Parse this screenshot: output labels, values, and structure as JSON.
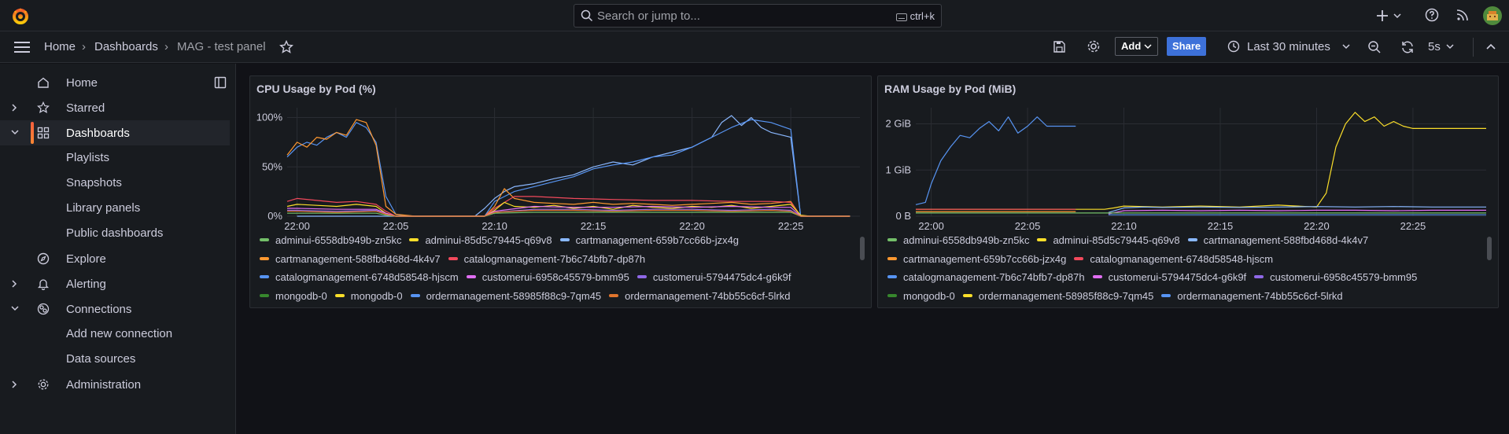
{
  "topbar": {
    "search_placeholder": "Search or jump to...",
    "search_shortcut": "ctrl+k",
    "icons": [
      "grafana-logo",
      "plus-icon",
      "help-icon",
      "rss-icon",
      "avatar"
    ]
  },
  "breadcrumb": {
    "items": [
      "Home",
      "Dashboards",
      "MAG - test panel"
    ]
  },
  "toolbar": {
    "add_label": "Add",
    "share_label": "Share",
    "time_range": "Last 30 minutes",
    "refresh_interval": "5s"
  },
  "sidebar": {
    "items": [
      {
        "label": "Home",
        "icon": "home-icon"
      },
      {
        "label": "Starred",
        "icon": "star-icon"
      },
      {
        "label": "Dashboards",
        "icon": "apps-icon"
      },
      {
        "label": "Playlists"
      },
      {
        "label": "Snapshots"
      },
      {
        "label": "Library panels"
      },
      {
        "label": "Public dashboards"
      },
      {
        "label": "Explore",
        "icon": "compass-icon"
      },
      {
        "label": "Alerting",
        "icon": "bell-icon"
      },
      {
        "label": "Connections",
        "icon": "plug-icon"
      },
      {
        "label": "Add new connection"
      },
      {
        "label": "Data sources"
      },
      {
        "label": "Administration",
        "icon": "cog-icon"
      }
    ]
  },
  "colors": {
    "green": "#73bf69",
    "yellow": "#fade2a",
    "lightblue": "#8ab8ff",
    "orange": "#ff9830",
    "red": "#f2495c",
    "blue": "#5794f2",
    "pink": "#e06ef2",
    "purple": "#8f68e6",
    "darkorange": "#e0752d",
    "darkgreen": "#37872d"
  },
  "panels": [
    {
      "title": "CPU Usage by Pod (%)",
      "legend_rows": [
        [
          {
            "name": "adminui-6558db949b-zn5kc",
            "color": "#73bf69"
          },
          {
            "name": "adminui-85d5c79445-q69v8",
            "color": "#fade2a"
          },
          {
            "name": "cartmanagement-659b7cc66b-jzx4g",
            "color": "#8ab8ff"
          }
        ],
        [
          {
            "name": "cartmanagement-588fbd468d-4k4v7",
            "color": "#ff9830"
          },
          {
            "name": "catalogmanagement-7b6c74bfb7-dp87h",
            "color": "#f2495c"
          }
        ],
        [
          {
            "name": "catalogmanagement-6748d58548-hjscm",
            "color": "#5794f2"
          },
          {
            "name": "customerui-6958c45579-bmm95",
            "color": "#e06ef2"
          },
          {
            "name": "customerui-5794475dc4-g6k9f",
            "color": "#8f68e6"
          }
        ],
        [
          {
            "name": "mongodb-0",
            "color": "#37872d"
          },
          {
            "name": "mongodb-0",
            "color": "#fade2a"
          },
          {
            "name": "ordermanagement-58985f88c9-7qm45",
            "color": "#5794f2"
          },
          {
            "name": "ordermanagement-74bb55c6cf-5lrkd",
            "color": "#e0752d"
          }
        ]
      ]
    },
    {
      "title": "RAM Usage by Pod (MiB)",
      "legend_rows": [
        [
          {
            "name": "adminui-6558db949b-zn5kc",
            "color": "#73bf69"
          },
          {
            "name": "adminui-85d5c79445-q69v8",
            "color": "#fade2a"
          },
          {
            "name": "cartmanagement-588fbd468d-4k4v7",
            "color": "#8ab8ff"
          }
        ],
        [
          {
            "name": "cartmanagement-659b7cc66b-jzx4g",
            "color": "#ff9830"
          },
          {
            "name": "catalogmanagement-6748d58548-hjscm",
            "color": "#f2495c"
          }
        ],
        [
          {
            "name": "catalogmanagement-7b6c74bfb7-dp87h",
            "color": "#5794f2"
          },
          {
            "name": "customerui-5794475dc4-g6k9f",
            "color": "#e06ef2"
          },
          {
            "name": "customerui-6958c45579-bmm95",
            "color": "#8f68e6"
          }
        ],
        [
          {
            "name": "mongodb-0",
            "color": "#37872d"
          },
          {
            "name": "ordermanagement-58985f88c9-7qm45",
            "color": "#fade2a"
          },
          {
            "name": "ordermanagement-74bb55c6cf-5lrkd",
            "color": "#5794f2"
          }
        ]
      ]
    }
  ],
  "chart_data": [
    {
      "type": "line",
      "title": "CPU Usage by Pod (%)",
      "x_ticks": [
        "22:00",
        "22:05",
        "22:10",
        "22:15",
        "22:20",
        "22:25"
      ],
      "y_ticks": [
        "0%",
        "50%",
        "100%"
      ],
      "ylim": [
        0,
        110
      ],
      "x_range_minutes": [
        -0.5,
        28.5
      ],
      "grid": true,
      "legend": "bottom",
      "series": [
        {
          "name": "cartmanagement-659b7cc66b-jzx4g",
          "color": "#8ab8ff",
          "x": [
            0,
            1,
            2,
            3,
            4,
            5,
            6,
            7,
            8,
            9,
            9.5,
            10,
            10.5,
            11,
            12,
            13,
            14,
            15,
            16,
            17,
            18,
            19,
            20,
            21,
            21.5,
            22,
            22.5,
            23,
            23.5,
            24,
            25,
            25.5,
            26,
            27,
            28
          ],
          "y": [
            0,
            0,
            0,
            0,
            0,
            0,
            0,
            0,
            0,
            0,
            8,
            18,
            25,
            30,
            33,
            38,
            42,
            50,
            55,
            52,
            60,
            65,
            70,
            80,
            95,
            102,
            92,
            100,
            90,
            85,
            80,
            0,
            0,
            0,
            0
          ]
        },
        {
          "name": "catalogmanagement-6748d58548-hjscm",
          "color": "#5794f2",
          "x": [
            -0.5,
            0,
            0.5,
            1,
            1.5,
            2,
            2.5,
            3,
            3.5,
            4,
            4.5,
            5,
            5.5,
            9.5,
            10,
            11,
            12,
            13,
            14,
            15,
            16,
            17,
            18,
            19,
            20,
            21,
            22,
            23,
            24,
            25,
            25.5,
            26,
            28
          ],
          "y": [
            60,
            70,
            75,
            72,
            80,
            85,
            80,
            95,
            90,
            75,
            20,
            2,
            0,
            0,
            15,
            25,
            30,
            35,
            40,
            48,
            52,
            55,
            60,
            62,
            70,
            80,
            90,
            98,
            95,
            88,
            0,
            0,
            0
          ]
        },
        {
          "name": "cartmanagement-588fbd468d-4k4v7",
          "color": "#ff9830",
          "x": [
            -0.5,
            0,
            0.5,
            1,
            1.5,
            2,
            2.5,
            3,
            3.5,
            4,
            4.5,
            5,
            6,
            9.5,
            10,
            10.5,
            11,
            12,
            13,
            14,
            15,
            16,
            17,
            18,
            19,
            20,
            21,
            22,
            23,
            24,
            25,
            25.5,
            26,
            28
          ],
          "y": [
            62,
            75,
            70,
            80,
            78,
            85,
            82,
            98,
            95,
            72,
            10,
            2,
            0,
            0,
            10,
            28,
            18,
            14,
            13,
            12,
            14,
            12,
            13,
            12,
            11,
            12,
            13,
            14,
            12,
            13,
            15,
            0,
            0,
            0
          ]
        },
        {
          "name": "catalogmanagement-7b6c74bfb7-dp87h",
          "color": "#f2495c",
          "x": [
            -0.5,
            0,
            1,
            2,
            3,
            4,
            4.5,
            5,
            9.5,
            10,
            11,
            12,
            14,
            16,
            18,
            20,
            22,
            24,
            25,
            25.5,
            28
          ],
          "y": [
            15,
            18,
            16,
            14,
            15,
            12,
            5,
            0,
            0,
            8,
            20,
            20,
            18,
            17,
            16,
            16,
            15,
            15,
            14,
            0,
            0
          ]
        },
        {
          "name": "adminui-85d5c79445-q69v8",
          "color": "#fade2a",
          "x": [
            -0.5,
            0,
            1,
            2,
            3,
            4,
            4.5,
            5,
            9.5,
            10,
            10.5,
            11,
            12,
            13,
            14,
            15,
            16,
            17,
            18,
            19,
            20,
            21,
            22,
            23,
            24,
            25,
            25.5,
            26,
            28
          ],
          "y": [
            10,
            12,
            11,
            10,
            12,
            10,
            3,
            0,
            0,
            6,
            14,
            10,
            9,
            11,
            8,
            10,
            7,
            11,
            9,
            8,
            10,
            9,
            11,
            8,
            10,
            12,
            1,
            0,
            0
          ]
        },
        {
          "name": "customerui-6958c45579-bmm95",
          "color": "#e06ef2",
          "x": [
            -0.5,
            0,
            2,
            4,
            4.5,
            5,
            9.5,
            10,
            12,
            14,
            16,
            18,
            20,
            22,
            24,
            25,
            25.5,
            28
          ],
          "y": [
            8,
            8,
            7,
            7,
            3,
            0,
            0,
            5,
            10,
            9,
            9,
            10,
            9,
            10,
            9,
            9,
            0,
            0
          ]
        },
        {
          "name": "customerui-5794475dc4-g6k9f",
          "color": "#8f68e6",
          "x": [
            -0.5,
            0,
            2,
            4,
            4.5,
            5,
            9.5,
            10,
            12,
            14,
            16,
            18,
            20,
            22,
            24,
            25,
            25.5,
            28
          ],
          "y": [
            6,
            6,
            5,
            6,
            2,
            0,
            0,
            4,
            7,
            7,
            6,
            7,
            7,
            6,
            7,
            6,
            0,
            0
          ]
        },
        {
          "name": "adminui-6558db949b-zn5kc",
          "color": "#73bf69",
          "x": [
            -0.5,
            0,
            2,
            4,
            4.5,
            5,
            9.5,
            10,
            12,
            14,
            16,
            18,
            20,
            22,
            24,
            25,
            25.5,
            28
          ],
          "y": [
            3,
            3,
            3,
            3,
            1,
            0,
            0,
            3,
            4,
            4,
            4,
            4,
            4,
            4,
            4,
            4,
            0,
            0
          ]
        },
        {
          "name": "ordermanagement-74bb55c6cf-5lrkd",
          "color": "#e0752d",
          "x": [
            -0.5,
            0,
            2,
            4,
            4.5,
            5,
            9.5,
            10,
            12,
            14,
            16,
            18,
            20,
            22,
            24,
            25,
            25.5,
            28
          ],
          "y": [
            5,
            5,
            4,
            5,
            2,
            0,
            0,
            4,
            6,
            6,
            5,
            6,
            6,
            5,
            6,
            5,
            0,
            0
          ]
        }
      ]
    },
    {
      "type": "line",
      "title": "RAM Usage by Pod (MiB)",
      "x_ticks": [
        "22:00",
        "22:05",
        "22:10",
        "22:15",
        "22:20",
        "22:25"
      ],
      "y_ticks": [
        "0 B",
        "1 GiB",
        "2 GiB"
      ],
      "ylim": [
        0,
        2.35
      ],
      "x_range_minutes": [
        -0.8,
        28.8
      ],
      "grid": true,
      "legend": "bottom",
      "series": [
        {
          "name": "catalogmanagement-7b6c74bfb7-dp87h",
          "color": "#5794f2",
          "x": [
            -0.8,
            -0.3,
            0,
            0.5,
            1,
            1.5,
            2,
            2.5,
            3,
            3.5,
            4,
            4.5,
            5,
            5.5,
            6,
            6.5,
            7,
            7.5
          ],
          "y": [
            0.25,
            0.3,
            0.7,
            1.2,
            1.5,
            1.75,
            1.7,
            1.9,
            2.05,
            1.85,
            2.15,
            1.8,
            1.95,
            2.15,
            1.95,
            1.95,
            1.95,
            1.95
          ]
        },
        {
          "name": "ordermanagement-58985f88c9-7qm45",
          "color": "#fade2a",
          "x": [
            -0.8,
            7.5,
            9,
            9.5,
            10,
            12,
            14,
            16,
            18,
            20,
            20.5,
            21,
            21.5,
            22,
            22.5,
            23,
            23.5,
            24,
            24.5,
            25,
            26,
            27,
            28.8
          ],
          "y": [
            0.15,
            0.15,
            0.15,
            0.18,
            0.22,
            0.2,
            0.22,
            0.2,
            0.24,
            0.2,
            0.5,
            1.5,
            2.0,
            2.25,
            2.05,
            2.15,
            1.95,
            2.05,
            1.95,
            1.9,
            1.9,
            1.9,
            1.9
          ]
        },
        {
          "name": "catalogmanagement-6748d58548-hjscm",
          "color": "#f2495c",
          "x": [
            -0.8,
            7.5
          ],
          "y": [
            0.15,
            0.15
          ]
        },
        {
          "name": "cartmanagement-588fbd468d-4k4v7",
          "color": "#8ab8ff",
          "x": [
            9.2,
            10,
            11,
            12,
            14,
            16,
            18,
            20,
            22,
            24,
            26,
            28.8
          ],
          "y": [
            0.08,
            0.18,
            0.2,
            0.19,
            0.2,
            0.19,
            0.2,
            0.21,
            0.2,
            0.21,
            0.2,
            0.2
          ]
        },
        {
          "name": "customerui-5794475dc4-g6k9f",
          "color": "#e06ef2",
          "x": [
            9.2,
            10,
            12,
            14,
            16,
            18,
            20,
            22,
            24,
            26,
            28.8
          ],
          "y": [
            0.05,
            0.12,
            0.13,
            0.12,
            0.13,
            0.12,
            0.13,
            0.13,
            0.12,
            0.13,
            0.13
          ]
        },
        {
          "name": "adminui-6558db949b-zn5kc",
          "color": "#73bf69",
          "x": [
            -0.8,
            28.8
          ],
          "y": [
            0.07,
            0.07
          ]
        },
        {
          "name": "cartmanagement-659b7cc66b-jzx4g",
          "color": "#ff9830",
          "x": [
            -0.8,
            7.5
          ],
          "y": [
            0.1,
            0.1
          ]
        },
        {
          "name": "ordermanagement-74bb55c6cf-5lrkd",
          "color": "#5794f2",
          "x": [
            9.2,
            28.8
          ],
          "y": [
            0.03,
            0.03
          ]
        }
      ]
    }
  ]
}
